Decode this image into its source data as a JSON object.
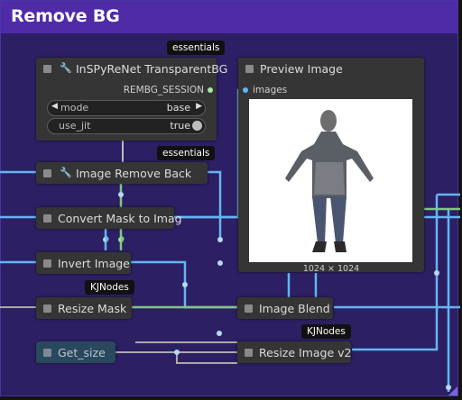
{
  "group": {
    "title": "Remove BG"
  },
  "nodes": {
    "inspy": {
      "title": "InSPyReNet TransparentBG",
      "badge": "essentials",
      "output": "REMBG_SESSION",
      "widgets": {
        "mode": {
          "label": "mode",
          "value": "base"
        },
        "use_jit": {
          "label": "use_jit",
          "value": "true"
        }
      }
    },
    "preview": {
      "title": "Preview Image",
      "input": "images",
      "size_label": "1024 × 1024"
    },
    "remove_back": {
      "title": "Image Remove Back",
      "badge": "essentials"
    },
    "convert_mask": {
      "title": "Convert Mask to Imag"
    },
    "invert": {
      "title": "Invert Image"
    },
    "resize_mask": {
      "title": "Resize Mask",
      "badge": "KJNodes"
    },
    "image_blend": {
      "title": "Image Blend"
    },
    "get_size": {
      "title": "Get_size"
    },
    "resize_image": {
      "title": "Resize Image v2",
      "badge": "KJNodes"
    }
  },
  "colors": {
    "group_bg": "#2d1f63",
    "group_header": "#4f2ba7",
    "node_bg": "#353535",
    "image_wire": "#64b5f6",
    "mask_wire": "#81c784",
    "int_wire": "#aaaaaa",
    "get_size_bg": "#29485e"
  },
  "icons": {
    "wrench": "wrench-icon",
    "collapse": "collapse-dot-icon"
  }
}
